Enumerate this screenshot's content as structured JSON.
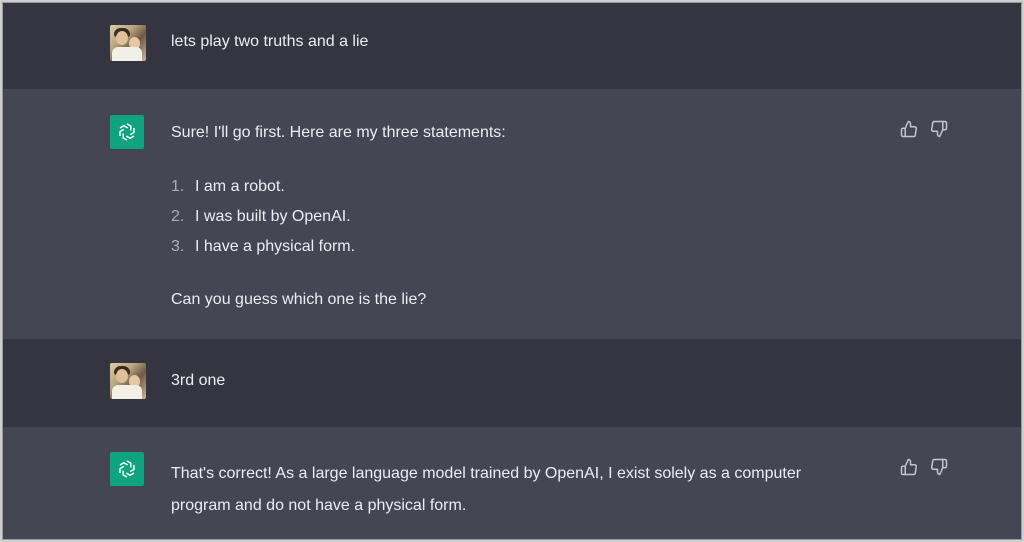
{
  "conversation": {
    "messages": [
      {
        "role": "user",
        "avatar": "user-photo",
        "text": "lets play two truths and a lie"
      },
      {
        "role": "assistant",
        "avatar": "openai-logo-icon",
        "intro": "Sure! I'll go first. Here are my three statements:",
        "list": [
          {
            "num": "1.",
            "text": "I am a robot."
          },
          {
            "num": "2.",
            "text": "I was built by OpenAI."
          },
          {
            "num": "3.",
            "text": "I have a physical form."
          }
        ],
        "outro": "Can you guess which one is the lie?"
      },
      {
        "role": "user",
        "avatar": "user-photo",
        "text": "3rd one"
      },
      {
        "role": "assistant",
        "avatar": "openai-logo-icon",
        "line1": "That's correct! As a large language model trained by OpenAI, I exist solely as a computer",
        "line2": "program and do not have a physical form."
      }
    ],
    "feedback_icons": [
      "thumbs-up-icon",
      "thumbs-down-icon"
    ]
  },
  "colors": {
    "user_row_bg": "#343541",
    "assistant_row_bg": "#444654",
    "openai_green": "#10a37f",
    "text": "#ececf1"
  }
}
